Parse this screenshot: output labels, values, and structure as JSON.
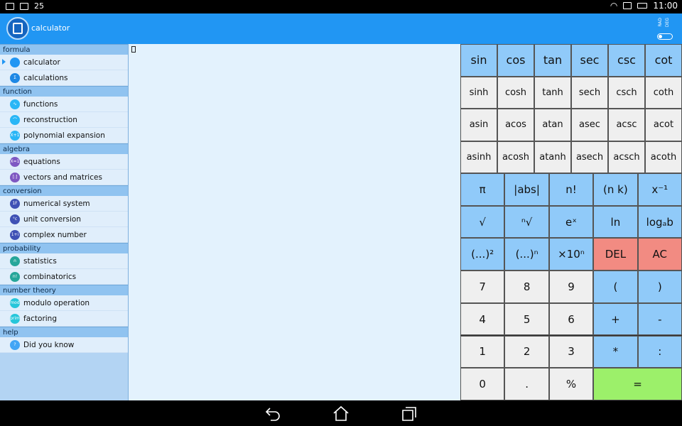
{
  "status": {
    "battery_text": "25",
    "time": "11:00"
  },
  "app": {
    "title": "calculator"
  },
  "toggle": {
    "rad": "RAD",
    "deg": "DEG"
  },
  "sidebar": {
    "sections": [
      {
        "title": "formula",
        "items": [
          {
            "label": "calculator",
            "icon": "calculator-icon",
            "color": "#2196f3",
            "glyph": "",
            "selected": true
          },
          {
            "label": "calculations",
            "icon": "sigma-icon",
            "color": "#1e88e5",
            "glyph": "Σ",
            "selected": false
          }
        ]
      },
      {
        "title": "function",
        "items": [
          {
            "label": "functions",
            "icon": "wave-icon",
            "color": "#29b6f6",
            "glyph": "∿",
            "selected": false
          },
          {
            "label": "reconstruction",
            "icon": "curve-icon",
            "color": "#29b6f6",
            "glyph": "⌒",
            "selected": false
          },
          {
            "label": "polynomial expansion",
            "icon": "polynomial-icon",
            "color": "#29b6f6",
            "glyph": "X+1",
            "selected": false
          }
        ]
      },
      {
        "title": "algebra",
        "items": [
          {
            "label": "equations",
            "icon": "equation-icon",
            "color": "#7e57c2",
            "glyph": "X=1",
            "selected": false
          },
          {
            "label": "vectors and matrices",
            "icon": "matrix-icon",
            "color": "#7e57c2",
            "glyph": "[:]",
            "selected": false
          }
        ]
      },
      {
        "title": "conversion",
        "items": [
          {
            "label": "numerical system",
            "icon": "hex-icon",
            "color": "#3f51b5",
            "glyph": "1F",
            "selected": false
          },
          {
            "label": "unit conversion",
            "icon": "thermometer-icon",
            "color": "#3f51b5",
            "glyph": "°c",
            "selected": false
          },
          {
            "label": "complex number",
            "icon": "complex-icon",
            "color": "#3f51b5",
            "glyph": "1+i",
            "selected": false
          }
        ]
      },
      {
        "title": "probability",
        "items": [
          {
            "label": "statistics",
            "icon": "bell-curve-icon",
            "color": "#26a69a",
            "glyph": "∩",
            "selected": false
          },
          {
            "label": "combinatorics",
            "icon": "factorial-icon",
            "color": "#26a69a",
            "glyph": "n!",
            "selected": false
          }
        ]
      },
      {
        "title": "number theory",
        "items": [
          {
            "label": "modulo operation",
            "icon": "mod-icon",
            "color": "#26c6da",
            "glyph": "mod",
            "selected": false
          },
          {
            "label": "factoring",
            "icon": "prime-icon",
            "color": "#26c6da",
            "glyph": "prim",
            "selected": false
          }
        ]
      },
      {
        "title": "help",
        "items": [
          {
            "label": "Did you know",
            "icon": "question-icon",
            "color": "#42a5f5",
            "glyph": "?",
            "selected": false
          }
        ]
      }
    ]
  },
  "keypad": {
    "trig_rows": [
      [
        "sin",
        "cos",
        "tan",
        "sec",
        "csc",
        "cot"
      ],
      [
        "sinh",
        "cosh",
        "tanh",
        "sech",
        "csch",
        "coth"
      ],
      [
        "asin",
        "acos",
        "atan",
        "asec",
        "acsc",
        "acot"
      ],
      [
        "asinh",
        "acosh",
        "atanh",
        "asech",
        "acsch",
        "acoth"
      ]
    ],
    "keys": [
      {
        "label": "π",
        "name": "pi-key",
        "style": "blue"
      },
      {
        "label": "|abs|",
        "name": "abs-key",
        "style": "blue"
      },
      {
        "label": "n!",
        "name": "factorial-key",
        "style": "blue"
      },
      {
        "label": "(n k)",
        "name": "binomial-key",
        "style": "blue"
      },
      {
        "label": "x⁻¹",
        "name": "inverse-key",
        "style": "blue"
      },
      {
        "label": "√",
        "name": "sqrt-key",
        "style": "blue"
      },
      {
        "label": "ⁿ√",
        "name": "nth-root-key",
        "style": "blue"
      },
      {
        "label": "eˣ",
        "name": "exp-key",
        "style": "blue"
      },
      {
        "label": "ln",
        "name": "ln-key",
        "style": "blue"
      },
      {
        "label": "logₐb",
        "name": "log-key",
        "style": "blue"
      },
      {
        "label": "(...)²",
        "name": "square-key",
        "style": "blue"
      },
      {
        "label": "(...)ⁿ",
        "name": "power-key",
        "style": "blue"
      },
      {
        "label": "×10ⁿ",
        "name": "sci-key",
        "style": "blue"
      },
      {
        "label": "DEL",
        "name": "delete-key",
        "style": "red"
      },
      {
        "label": "AC",
        "name": "clear-key",
        "style": "red"
      },
      {
        "label": "7",
        "name": "digit-7-key",
        "style": "grey"
      },
      {
        "label": "8",
        "name": "digit-8-key",
        "style": "grey"
      },
      {
        "label": "9",
        "name": "digit-9-key",
        "style": "grey"
      },
      {
        "label": "(",
        "name": "open-paren-key",
        "style": "blue"
      },
      {
        "label": ")",
        "name": "close-paren-key",
        "style": "blue"
      },
      {
        "label": "4",
        "name": "digit-4-key",
        "style": "grey"
      },
      {
        "label": "5",
        "name": "digit-5-key",
        "style": "grey"
      },
      {
        "label": "6",
        "name": "digit-6-key",
        "style": "grey"
      },
      {
        "label": "+",
        "name": "plus-key",
        "style": "blue"
      },
      {
        "label": "-",
        "name": "minus-key",
        "style": "blue"
      },
      {
        "label": "1",
        "name": "digit-1-key",
        "style": "grey"
      },
      {
        "label": "2",
        "name": "digit-2-key",
        "style": "grey"
      },
      {
        "label": "3",
        "name": "digit-3-key",
        "style": "grey"
      },
      {
        "label": "*",
        "name": "multiply-key",
        "style": "blue"
      },
      {
        "label": ":",
        "name": "divide-key",
        "style": "blue"
      },
      {
        "label": "0",
        "name": "digit-0-key",
        "style": "grey"
      },
      {
        "label": ".",
        "name": "decimal-key",
        "style": "grey"
      },
      {
        "label": "%",
        "name": "percent-key",
        "style": "grey"
      },
      {
        "label": "=",
        "name": "equals-key",
        "style": "green"
      }
    ]
  }
}
